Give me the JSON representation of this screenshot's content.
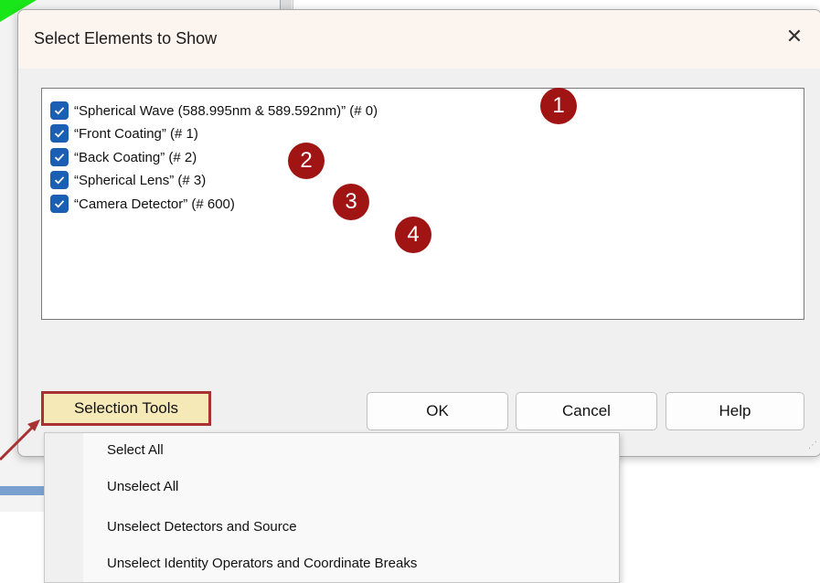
{
  "dialog": {
    "title": "Select Elements to Show",
    "close_glyph": "✕",
    "items": [
      {
        "label": "“Spherical Wave (588.995nm & 589.592nm)” (# 0)",
        "checked": true
      },
      {
        "label": "“Front Coating” (# 1)",
        "checked": true
      },
      {
        "label": "“Back Coating” (# 2)",
        "checked": true
      },
      {
        "label": "“Spherical Lens” (# 3)",
        "checked": true
      },
      {
        "label": "“Camera Detector” (# 600)",
        "checked": true
      }
    ],
    "badges": [
      "1",
      "2",
      "3",
      "4"
    ],
    "buttons": {
      "selection_tools": "Selection Tools",
      "ok": "OK",
      "cancel": "Cancel",
      "help": "Help"
    }
  },
  "menu": {
    "items": [
      "Select All",
      "Unselect All",
      "Unselect Detectors and Source",
      "Unselect Identity Operators and Coordinate Breaks"
    ]
  },
  "colors": {
    "checkbox": "#1a5fb4",
    "badge": "#a01414",
    "highlight_border": "#a83232",
    "highlight_fill": "#f6e9b8"
  }
}
